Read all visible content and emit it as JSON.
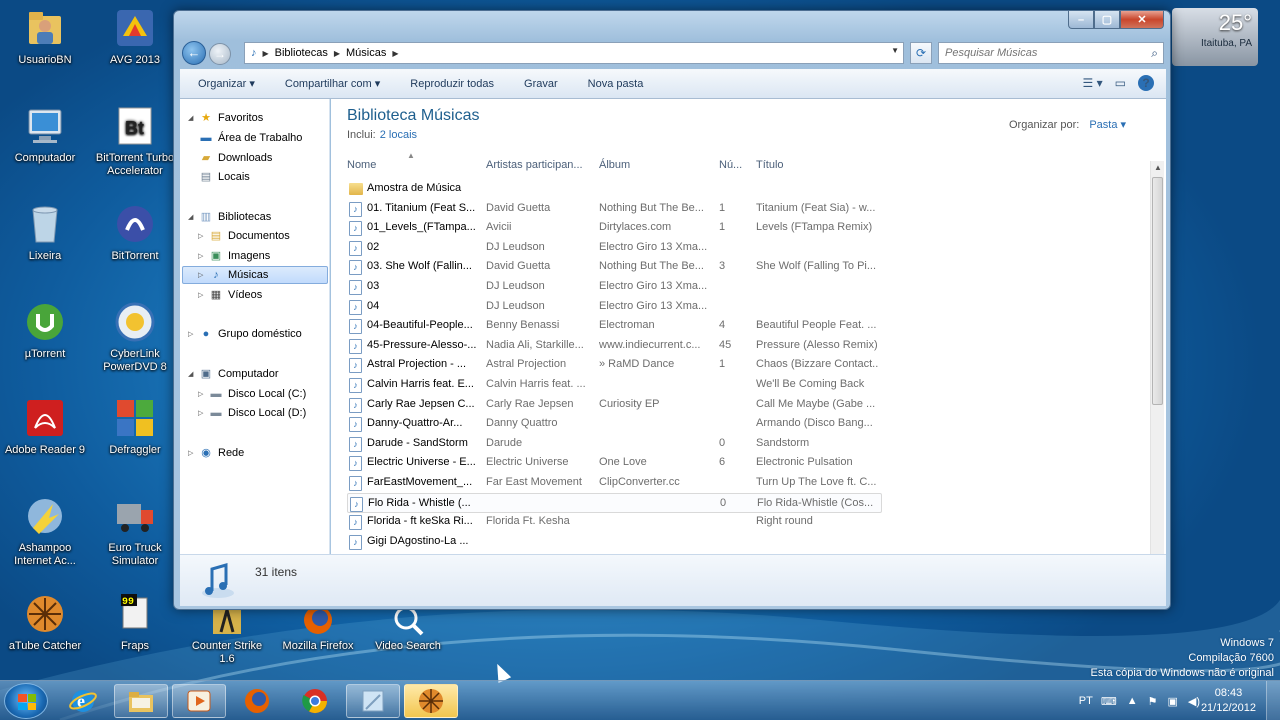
{
  "desktop_icons": [
    {
      "label": "UsuarioBN",
      "icon": "user-folder-icon"
    },
    {
      "label": "AVG 2013",
      "icon": "avg-icon"
    },
    {
      "label": "Computador",
      "icon": "computer-icon"
    },
    {
      "label": "BitTorrent Turbo Accelerator",
      "icon": "bittorrent-turbo-icon"
    },
    {
      "label": "Lixeira",
      "icon": "recycle-bin-icon"
    },
    {
      "label": "BitTorrent",
      "icon": "bittorrent-icon"
    },
    {
      "label": "µTorrent",
      "icon": "utorrent-icon"
    },
    {
      "label": "CyberLink PowerDVD 8",
      "icon": "powerdvd-icon"
    },
    {
      "label": "Adobe Reader 9",
      "icon": "adobe-reader-icon"
    },
    {
      "label": "Defraggler",
      "icon": "defraggler-icon"
    },
    {
      "label": "Ashampoo Internet Ac...",
      "icon": "ashampoo-icon"
    },
    {
      "label": "Euro Truck Simulator",
      "icon": "euro-truck-icon"
    },
    {
      "label": "aTube Catcher",
      "icon": "atube-catcher-icon"
    },
    {
      "label": "Fraps",
      "icon": "fraps-icon"
    },
    {
      "label": "Counter Strike 1.6",
      "icon": "counter-strike-icon"
    },
    {
      "label": "Mozilla Firefox",
      "icon": "firefox-icon"
    },
    {
      "label": "Video Search",
      "icon": "video-search-icon"
    }
  ],
  "weather": {
    "temp": "25°",
    "city": "Itaituba, PA"
  },
  "window": {
    "address": {
      "seg1": "Bibliotecas",
      "seg2": "Músicas"
    },
    "search_placeholder": "Pesquisar Músicas",
    "toolbar": {
      "organize": "Organizar",
      "share": "Compartilhar com",
      "play_all": "Reproduzir todas",
      "burn": "Gravar",
      "new_folder": "Nova pasta"
    },
    "nav": {
      "favorites": "Favoritos",
      "desktop": "Área de Trabalho",
      "downloads": "Downloads",
      "places": "Locais",
      "libraries": "Bibliotecas",
      "documents": "Documentos",
      "images": "Imagens",
      "music": "Músicas",
      "videos": "Vídeos",
      "homegroup": "Grupo doméstico",
      "computer": "Computador",
      "disk_c": "Disco Local (C:)",
      "disk_d": "Disco Local (D:)",
      "network": "Rede"
    },
    "library": {
      "title": "Biblioteca Músicas",
      "includes": "Inclui:",
      "locations": "2 locais",
      "arrange_by": "Organizar por:",
      "arrange_value": "Pasta ▾"
    },
    "columns": {
      "name": "Nome",
      "artist": "Artistas participan...",
      "album": "Álbum",
      "num": "Nú...",
      "title": "Título"
    },
    "files": [
      {
        "name": "Amostra de Música",
        "artist": "",
        "album": "",
        "num": "",
        "title": "",
        "folder": true
      },
      {
        "name": "01. Titanium (Feat S...",
        "artist": "David Guetta",
        "album": "Nothing But The Be...",
        "num": "1",
        "title": "Titanium (Feat Sia) - w..."
      },
      {
        "name": "01_Levels_(FTampa...",
        "artist": "Avicii",
        "album": "Dirtylaces.com",
        "num": "1",
        "title": "Levels (FTampa Remix)"
      },
      {
        "name": "02",
        "artist": "DJ Leudson",
        "album": "Electro Giro 13 Xma...",
        "num": "",
        "title": ""
      },
      {
        "name": "03. She Wolf (Fallin...",
        "artist": "David Guetta",
        "album": "Nothing But The Be...",
        "num": "3",
        "title": "She Wolf (Falling To Pi..."
      },
      {
        "name": "03",
        "artist": "DJ Leudson",
        "album": "Electro Giro 13 Xma...",
        "num": "",
        "title": ""
      },
      {
        "name": "04",
        "artist": "DJ Leudson",
        "album": "Electro Giro 13 Xma...",
        "num": "",
        "title": ""
      },
      {
        "name": "04-Beautiful-People...",
        "artist": "Benny Benassi",
        "album": "Electroman",
        "num": "4",
        "title": "Beautiful People Feat. ..."
      },
      {
        "name": "45-Pressure-Alesso-...",
        "artist": "Nadia Ali, Starkille...",
        "album": "www.indiecurrent.c...",
        "num": "45",
        "title": "Pressure (Alesso Remix)"
      },
      {
        "name": "Astral Projection - ...",
        "artist": "Astral Projection",
        "album": "» RaMD Dance",
        "num": "1",
        "title": "Chaos (Bizzare Contact..."
      },
      {
        "name": "Calvin Harris feat. E...",
        "artist": "Calvin Harris feat. ...",
        "album": "",
        "num": "",
        "title": "We'll Be Coming Back"
      },
      {
        "name": "Carly Rae Jepsen    C...",
        "artist": "Carly Rae Jepsen",
        "album": "Curiosity EP",
        "num": "",
        "title": "Call Me Maybe (Gabe ..."
      },
      {
        "name": "Danny-Quattro-Ar...",
        "artist": "Danny Quattro",
        "album": "",
        "num": "",
        "title": "Armando (Disco Bang..."
      },
      {
        "name": "Darude - SandStorm",
        "artist": "Darude",
        "album": "",
        "num": "0",
        "title": "Sandstorm"
      },
      {
        "name": "Electric Universe - E...",
        "artist": "Electric Universe",
        "album": "One Love",
        "num": "6",
        "title": "Electronic Pulsation"
      },
      {
        "name": "FarEastMovement_...",
        "artist": "Far East Movement",
        "album": "ClipConverter.cc",
        "num": "",
        "title": "Turn Up The Love ft. C..."
      },
      {
        "name": "Flo Rida - Whistle (...",
        "artist": "",
        "album": "",
        "num": "0",
        "title": "Flo Rida-Whistle (Cos..."
      },
      {
        "name": "Florida - ft keSka Ri...",
        "artist": "Florida Ft. Kesha",
        "album": "",
        "num": "",
        "title": "Right round"
      },
      {
        "name": "Gigi DAgostino-La ...",
        "artist": "",
        "album": "",
        "num": "",
        "title": ""
      }
    ],
    "status": {
      "count": "31 itens"
    }
  },
  "watermark": {
    "line1": "Windows 7",
    "line2": "Compilação 7600",
    "line3": "Esta cópia do Windows não é original"
  },
  "tray": {
    "lang": "PT",
    "time": "08:43",
    "date": "21/12/2012"
  }
}
